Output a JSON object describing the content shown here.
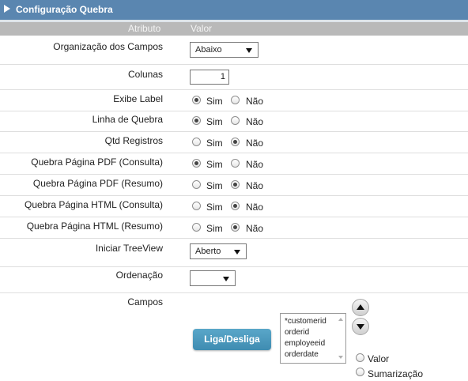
{
  "panel": {
    "title": "Configuração Quebra"
  },
  "columns": {
    "attribute": "Atributo",
    "value": "Valor"
  },
  "fields": {
    "organizacao": {
      "label": "Organização dos Campos",
      "value": "Abaixo"
    },
    "colunas": {
      "label": "Colunas",
      "value": "1"
    },
    "iniciar_treeview": {
      "label": "Iniciar TreeView",
      "value": "Aberto"
    },
    "ordenacao": {
      "label": "Ordenação",
      "value": ""
    },
    "campos": {
      "label": "Campos"
    }
  },
  "radio_options": {
    "yes": "Sim",
    "no": "Não"
  },
  "radio_rows": [
    {
      "label": "Exibe Label",
      "selected": "Sim"
    },
    {
      "label": "Linha de Quebra",
      "selected": "Sim"
    },
    {
      "label": "Qtd Registros",
      "selected": "Não"
    },
    {
      "label": "Quebra Página PDF (Consulta)",
      "selected": "Sim"
    },
    {
      "label": "Quebra Página PDF (Resumo)",
      "selected": "Não"
    },
    {
      "label": "Quebra Página HTML (Consulta)",
      "selected": "Não"
    },
    {
      "label": "Quebra Página HTML (Resumo)",
      "selected": "Não"
    }
  ],
  "campos_panel": {
    "toggle_button": "Liga/Desliga",
    "list_items": [
      "*customerid",
      "orderid",
      "employeeid",
      "orderdate"
    ],
    "mode_options": [
      "Valor",
      "Sumarização"
    ],
    "up_icon": "arrow-up-icon",
    "down_icon": "arrow-down-icon"
  },
  "colors": {
    "title_bar": "#5a86b0",
    "header_bar": "#b9b9b9",
    "button": "#4a98bd"
  }
}
